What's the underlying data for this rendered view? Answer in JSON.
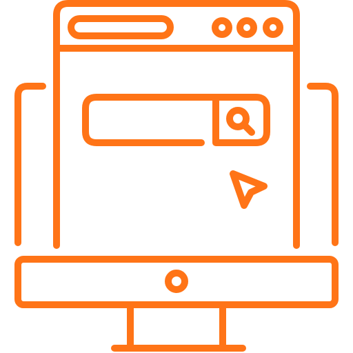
{
  "icon": {
    "name": "web-search-on-monitor-icon",
    "stroke_color": "#FF7417",
    "background_color": "#FFFFFF",
    "parts": {
      "monitor": "monitor-icon",
      "browser_window": "browser-window-icon",
      "address_bar": "address-bar-icon",
      "window_controls": "window-control-dots-icon",
      "search_field": "search-field-icon",
      "search_button": "search-magnifier-icon",
      "cursor": "mouse-pointer-icon",
      "power_button": "power-button-icon"
    }
  }
}
